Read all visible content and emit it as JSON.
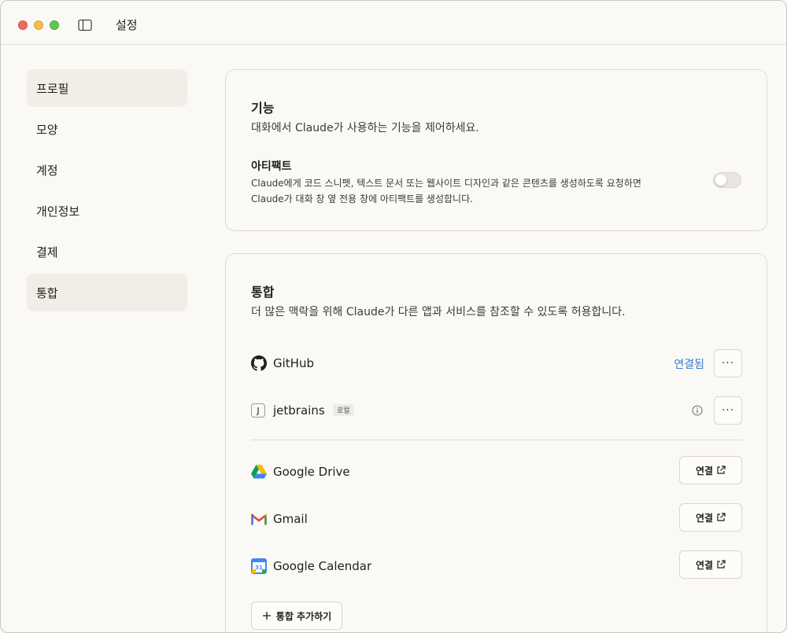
{
  "window": {
    "title": "설정"
  },
  "sidebar": {
    "items": [
      {
        "label": "프로필",
        "active": true
      },
      {
        "label": "모양",
        "active": false
      },
      {
        "label": "계정",
        "active": false
      },
      {
        "label": "개인정보",
        "active": false
      },
      {
        "label": "결제",
        "active": false
      },
      {
        "label": "통합",
        "active": true
      }
    ]
  },
  "features": {
    "title": "기능",
    "description": "대화에서 Claude가 사용하는 기능을 제어하세요.",
    "artifacts": {
      "title": "아티팩트",
      "description_line1": "Claude에게 코드 스니펫, 텍스트 문서 또는 웹사이트 디자인과 같은 콘텐츠를 생성하도록 요청하면",
      "description_line2": "Claude가 대화 창 옆 전용 창에 아티팩트를 생성합니다.",
      "enabled": false
    }
  },
  "integrations": {
    "title": "통합",
    "description": "더 많은 맥락을 위해 Claude가 다른 앱과 서비스를 참조할 수 있도록 허용합니다.",
    "connected": [
      {
        "name": "GitHub",
        "status": "연결됨",
        "icon": "github-icon"
      },
      {
        "name": "jetbrains",
        "badge": "로컬",
        "icon": "jetbrains-icon",
        "icon_letter": "J"
      }
    ],
    "available": [
      {
        "name": "Google Drive",
        "button": "연결",
        "icon": "google-drive-icon"
      },
      {
        "name": "Gmail",
        "button": "연결",
        "icon": "gmail-icon"
      },
      {
        "name": "Google Calendar",
        "button": "연결",
        "icon": "google-calendar-icon",
        "icon_text": "31"
      }
    ],
    "more_label": "···",
    "add_button": "통합 추가하기"
  },
  "colors": {
    "background": "#faf9f5",
    "link": "#3b7bd1",
    "active_nav": "#f0eee6",
    "border": "#dcdad2"
  }
}
